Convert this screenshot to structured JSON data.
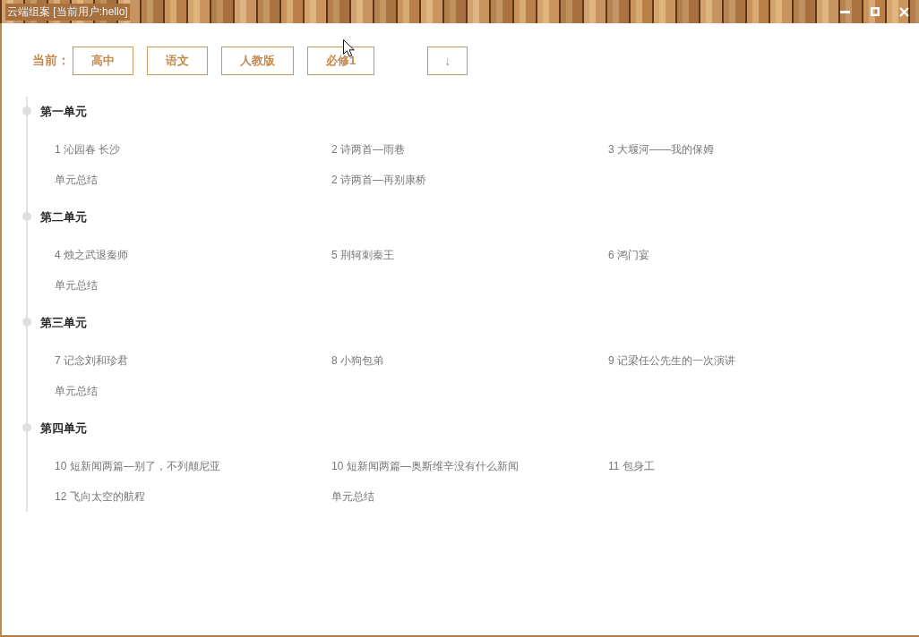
{
  "window": {
    "title": "云端组案 [当前用户:hello]"
  },
  "filter": {
    "label": "当前：",
    "chips": [
      "高中",
      "语文",
      "人教版",
      "必修1"
    ],
    "expand_button": "↓"
  },
  "units": [
    {
      "title": "第一单元",
      "lessons": [
        "1 沁园春 长沙",
        "2 诗两首—雨巷",
        "3 大堰河——我的保姆",
        "单元总结",
        "2 诗两首—再别康桥"
      ]
    },
    {
      "title": "第二单元",
      "lessons": [
        "4 烛之武退秦师",
        "5 荆轲刺秦王",
        "6 鸿门宴",
        "单元总结"
      ]
    },
    {
      "title": "第三单元",
      "lessons": [
        "7 记念刘和珍君",
        "8 小狗包弟",
        "9 记梁任公先生的一次演讲",
        "单元总结"
      ]
    },
    {
      "title": "第四单元",
      "lessons": [
        "10 短新闻两篇—别了，不列颠尼亚",
        "10 短新闻两篇—奥斯维辛没有什么新闻",
        "11 包身工",
        "12 飞向太空的航程",
        "单元总结"
      ]
    }
  ]
}
